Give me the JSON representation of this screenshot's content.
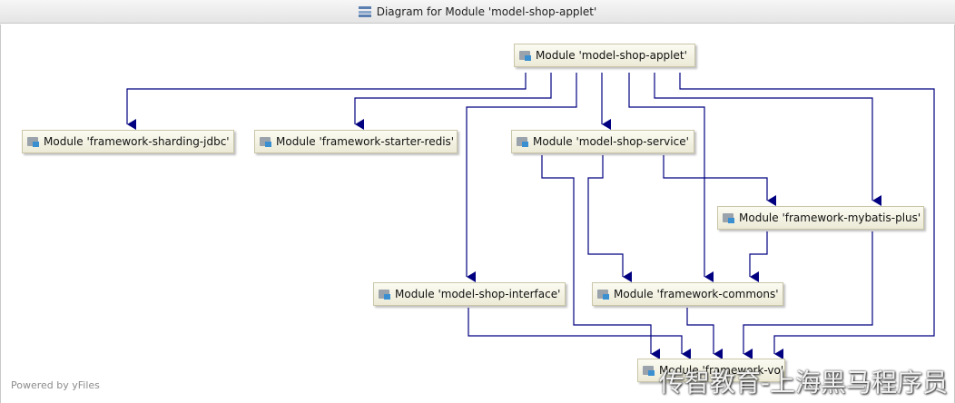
{
  "window": {
    "title": "Diagram for Module 'model-shop-applet'"
  },
  "nodes": {
    "applet": "Module 'model-shop-applet'",
    "sharding": "Module 'framework-sharding-jdbc'",
    "redis": "Module 'framework-starter-redis'",
    "service": "Module 'model-shop-service'",
    "mybatis": "Module 'framework-mybatis-plus'",
    "interface": "Module 'model-shop-interface'",
    "commons": "Module 'framework-commons'",
    "vo": "Module 'framework-vo'"
  },
  "footer": {
    "powered": "Powered by yFiles"
  },
  "watermark": {
    "text": "传智教育-上海黑马程序员"
  },
  "colors": {
    "edge": "#000080",
    "node_fill": "#f3f1df"
  }
}
